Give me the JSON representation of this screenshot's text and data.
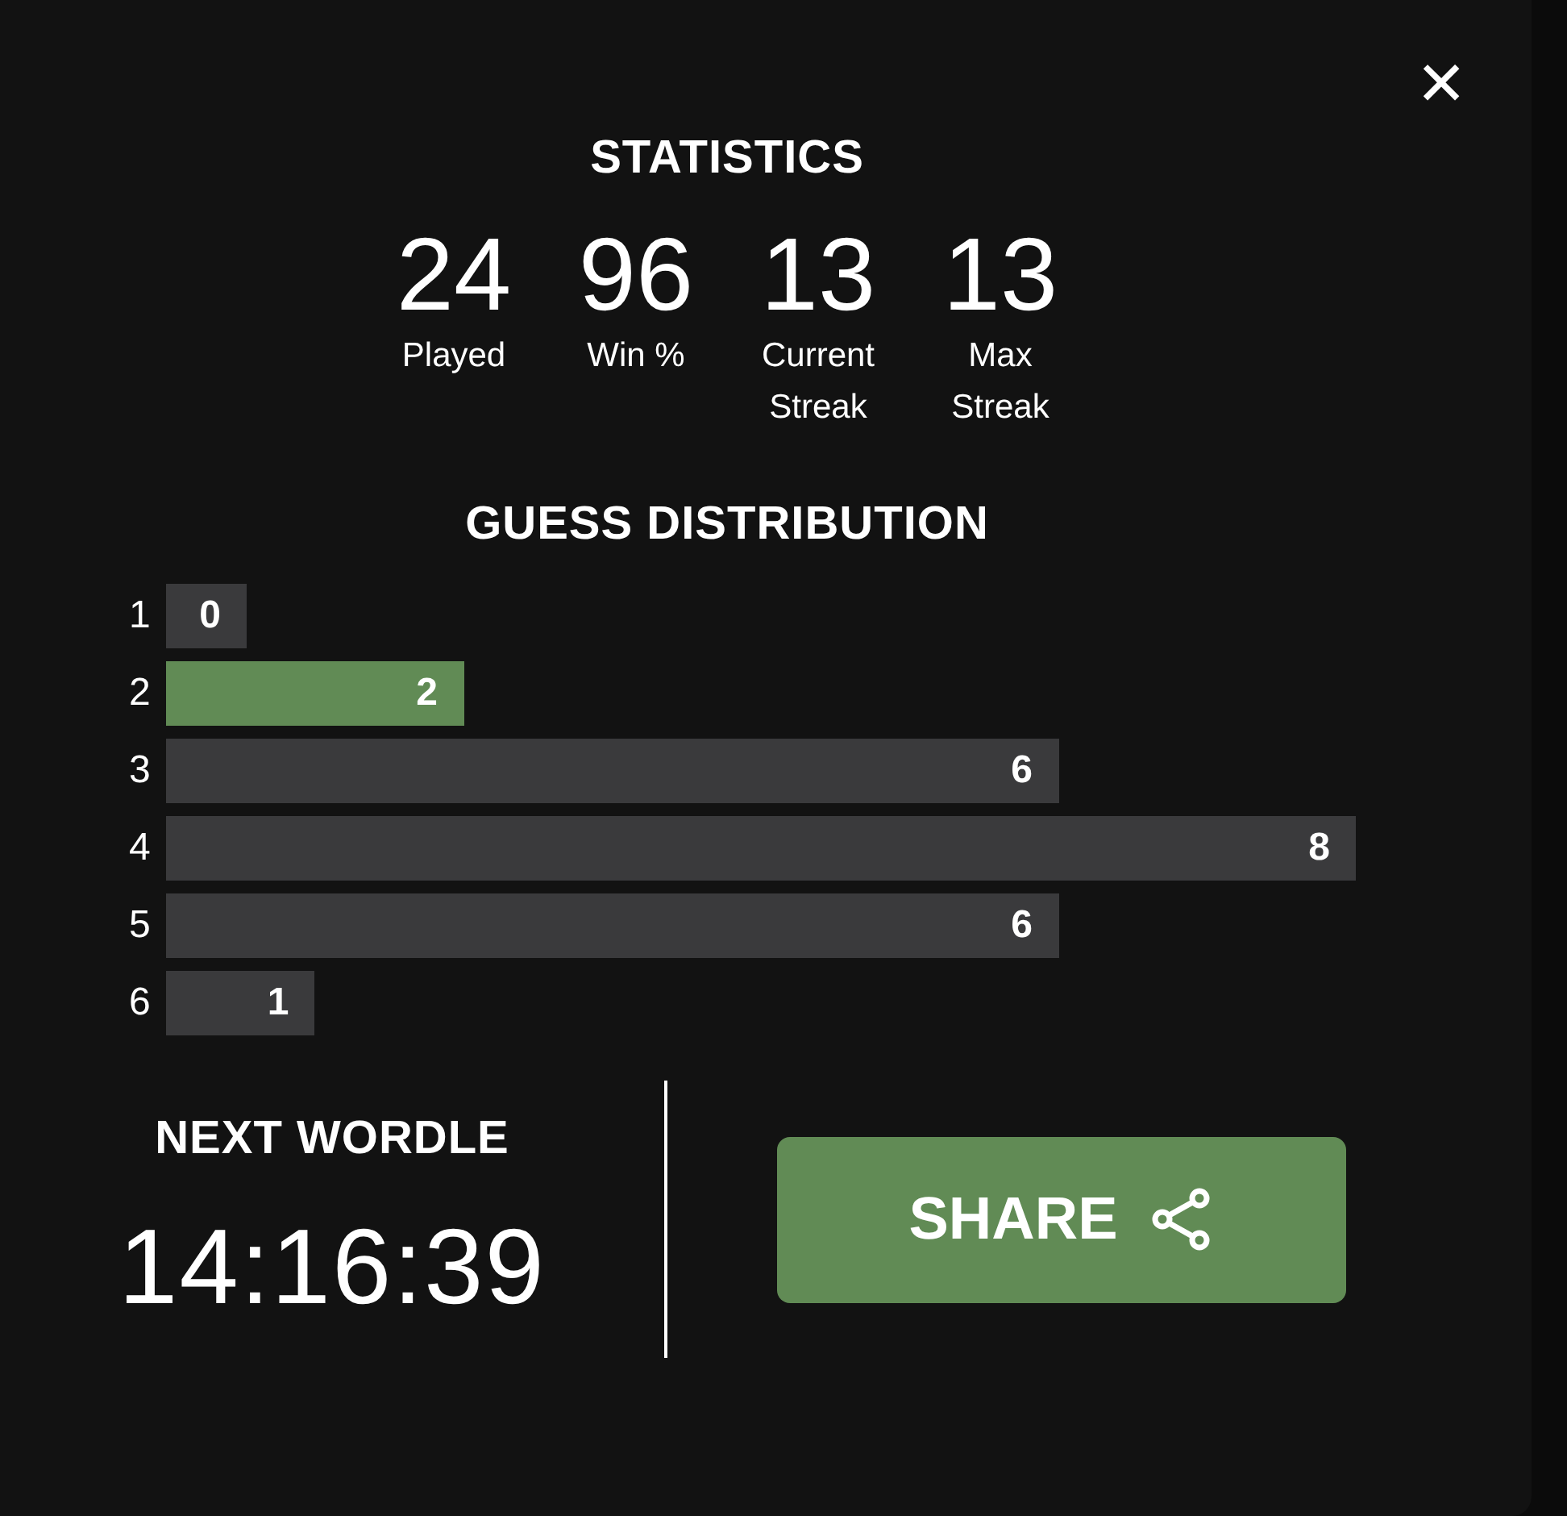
{
  "close_button": {
    "label": "✕"
  },
  "title": "STATISTICS",
  "stats": [
    {
      "value": "24",
      "label": "Played"
    },
    {
      "value": "96",
      "label": "Win %"
    },
    {
      "value": "13",
      "label": "Current Streak"
    },
    {
      "value": "13",
      "label": "Max Streak"
    }
  ],
  "guess_distribution": {
    "title": "GUESS DISTRIBUTION",
    "rows": [
      {
        "guess": "1",
        "count": "0",
        "selected": false
      },
      {
        "guess": "2",
        "count": "2",
        "selected": true
      },
      {
        "guess": "3",
        "count": "6",
        "selected": false
      },
      {
        "guess": "4",
        "count": "8",
        "selected": false
      },
      {
        "guess": "5",
        "count": "6",
        "selected": false
      },
      {
        "guess": "6",
        "count": "1",
        "selected": false
      }
    ]
  },
  "next_wordle": {
    "label": "NEXT WORDLE",
    "countdown": "14:16:39"
  },
  "share_button": {
    "label": "SHARE"
  }
}
